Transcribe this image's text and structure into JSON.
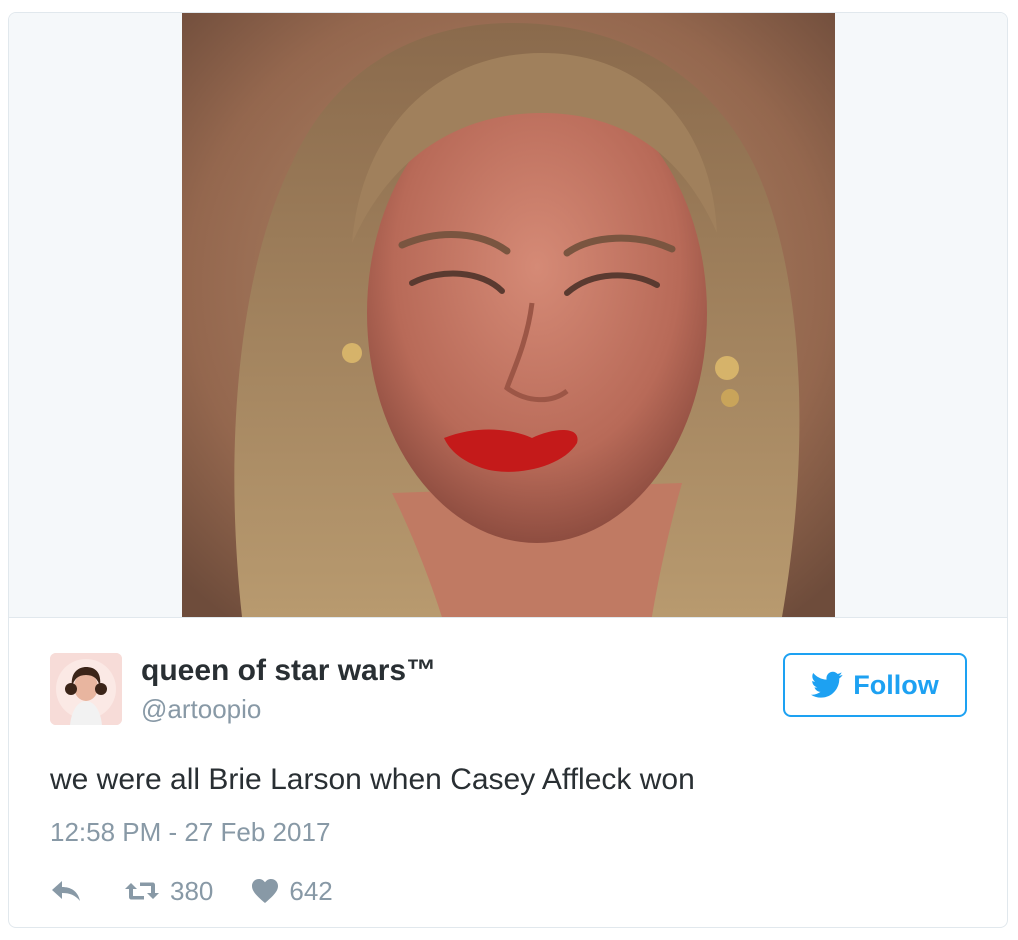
{
  "tweet": {
    "author": {
      "display_name": "queen of star wars™",
      "handle": "@artoopio",
      "avatar": "avatar-woman-portrait"
    },
    "follow_label": "Follow",
    "text": "we were all Brie Larson when Casey Affleck won",
    "timestamp": "12:58 PM - 27 Feb 2017",
    "stats": {
      "retweets": "380",
      "likes": "642"
    },
    "icons": {
      "follow": "twitter-bird-icon",
      "reply": "reply-icon",
      "retweet": "retweet-icon",
      "like": "heart-icon"
    },
    "colors": {
      "accent": "#1da1f2",
      "muted": "#8899a6",
      "text": "#292f33",
      "border": "#e1e8ed"
    }
  }
}
